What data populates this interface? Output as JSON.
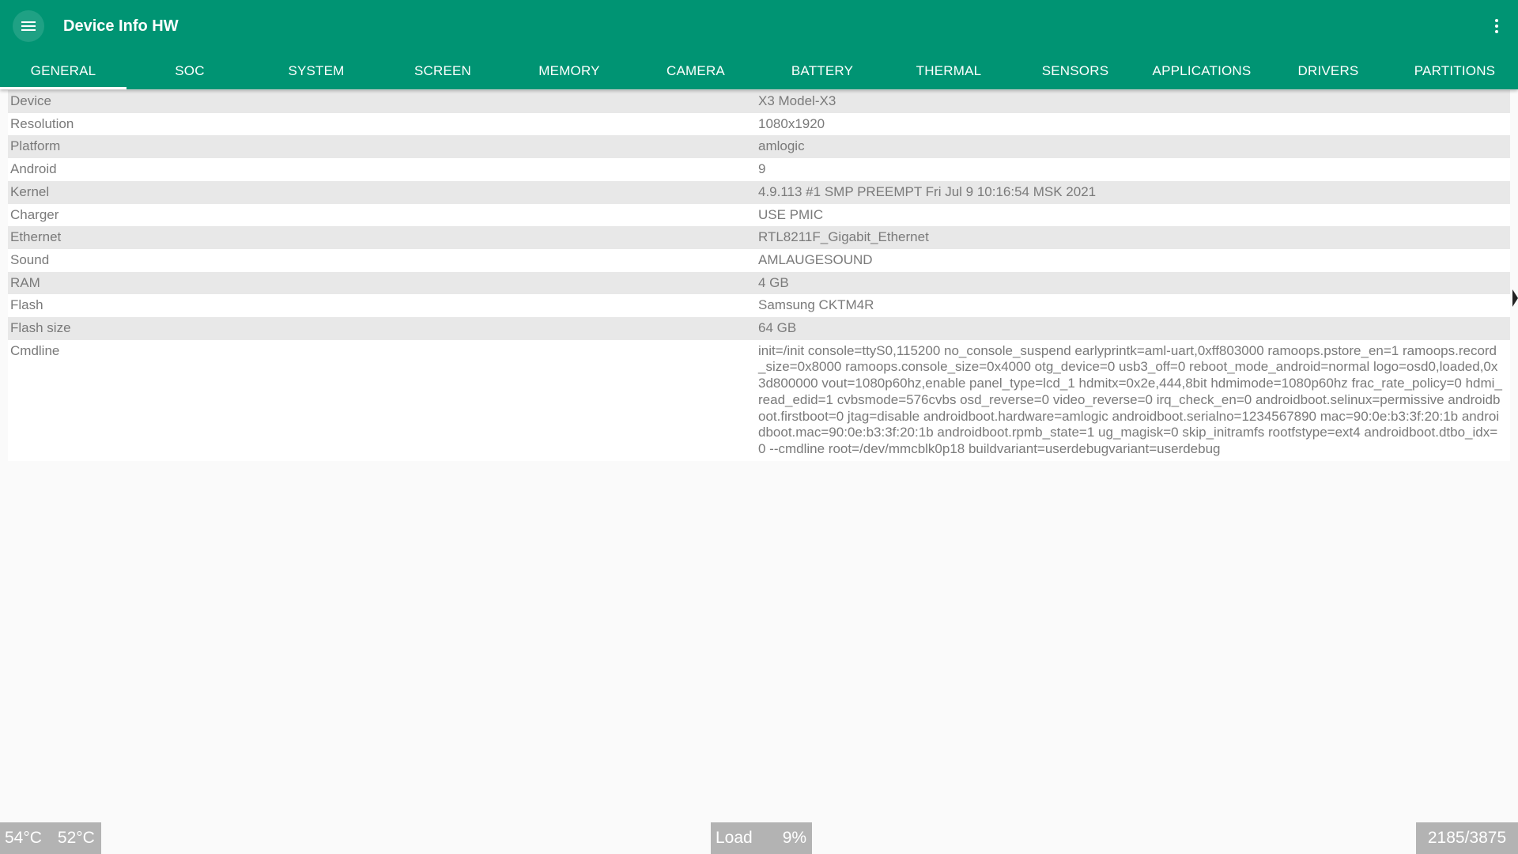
{
  "app": {
    "title": "Device Info HW"
  },
  "colors": {
    "appbar": "#009473",
    "badge": "#b3b3b3"
  },
  "toolbar": {
    "menu_icon": "hamburger-menu-icon",
    "overflow_icon": "more-vert-icon"
  },
  "tabs": [
    {
      "label": "GENERAL",
      "active": true
    },
    {
      "label": "SOC"
    },
    {
      "label": "SYSTEM"
    },
    {
      "label": "SCREEN"
    },
    {
      "label": "MEMORY"
    },
    {
      "label": "CAMERA"
    },
    {
      "label": "BATTERY"
    },
    {
      "label": "THERMAL"
    },
    {
      "label": "SENSORS"
    },
    {
      "label": "APPLICATIONS"
    },
    {
      "label": "DRIVERS"
    },
    {
      "label": "PARTITIONS"
    }
  ],
  "rows": [
    {
      "key": "Device",
      "value": "X3 Model-X3"
    },
    {
      "key": "Resolution",
      "value": "1080x1920"
    },
    {
      "key": "Platform",
      "value": "amlogic"
    },
    {
      "key": "Android",
      "value": "9"
    },
    {
      "key": "Kernel",
      "value": "4.9.113 #1 SMP PREEMPT Fri Jul 9 10:16:54 MSK 2021"
    },
    {
      "key": "Charger",
      "value": "USE PMIC"
    },
    {
      "key": "Ethernet",
      "value": "RTL8211F_Gigabit_Ethernet"
    },
    {
      "key": "Sound",
      "value": "AMLAUGESOUND"
    },
    {
      "key": "RAM",
      "value": "4 GB"
    },
    {
      "key": "Flash",
      "value": "Samsung CKTM4R"
    },
    {
      "key": "Flash size",
      "value": "64 GB"
    },
    {
      "key": "Cmdline",
      "value": "init=/init console=ttyS0,115200 no_console_suspend earlyprintk=aml-uart,0xff803000 ramoops.pstore_en=1 ramoops.record_size=0x8000 ramoops.console_size=0x4000 otg_device=0 usb3_off=0 reboot_mode_android=normal logo=osd0,loaded,0x3d800000 vout=1080p60hz,enable panel_type=lcd_1 hdmitx=0x2e,444,8bit hdmimode=1080p60hz frac_rate_policy=0 hdmi_read_edid=1 cvbsmode=576cvbs osd_reverse=0 video_reverse=0 irq_check_en=0 androidboot.selinux=permissive androidboot.firstboot=0 jtag=disable androidboot.hardware=amlogic androidboot.serialno=1234567890 mac=90:0e:b3:3f:20:1b androidboot.mac=90:0e:b3:3f:20:1b androidboot.rpmb_state=1 ug_magisk=0 skip_initramfs rootfstype=ext4 androidboot.dtbo_idx=0 --cmdline root=/dev/mmcblk0p18 buildvariant=userdebugvariant=userdebug"
    }
  ],
  "status": {
    "temp1": "54°C",
    "temp2": "52°C",
    "load_label": "Load",
    "load_value": "9%",
    "memory": "2185/3875"
  }
}
